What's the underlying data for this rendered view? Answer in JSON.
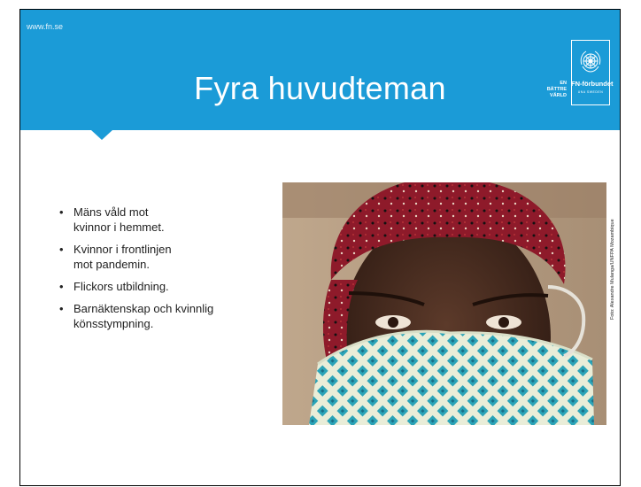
{
  "header": {
    "site_url": "www.fn.se",
    "title": "Fyra huvudteman",
    "background_color": "#1b9bd7"
  },
  "logo": {
    "tagline": [
      "EN",
      "BÄTTRE",
      "VÄRLD"
    ],
    "name": "FN-förbundet",
    "sub": "UNA SWEDEN",
    "emblem": "un-emblem-icon"
  },
  "bullets": [
    {
      "line1": "Mäns våld mot",
      "line2": "kvinnor i hemmet."
    },
    {
      "line1": "Kvinnor i frontlinjen",
      "line2": "mot pandemin."
    },
    {
      "line1": "Flickors utbildning.",
      "line2": ""
    },
    {
      "line1": "Barnäktenskap och kvinnlig",
      "line2": "könsstympning."
    }
  ],
  "photo": {
    "credit": "Foto: Alexandre Mulanga/UNFPA Mozambique"
  }
}
